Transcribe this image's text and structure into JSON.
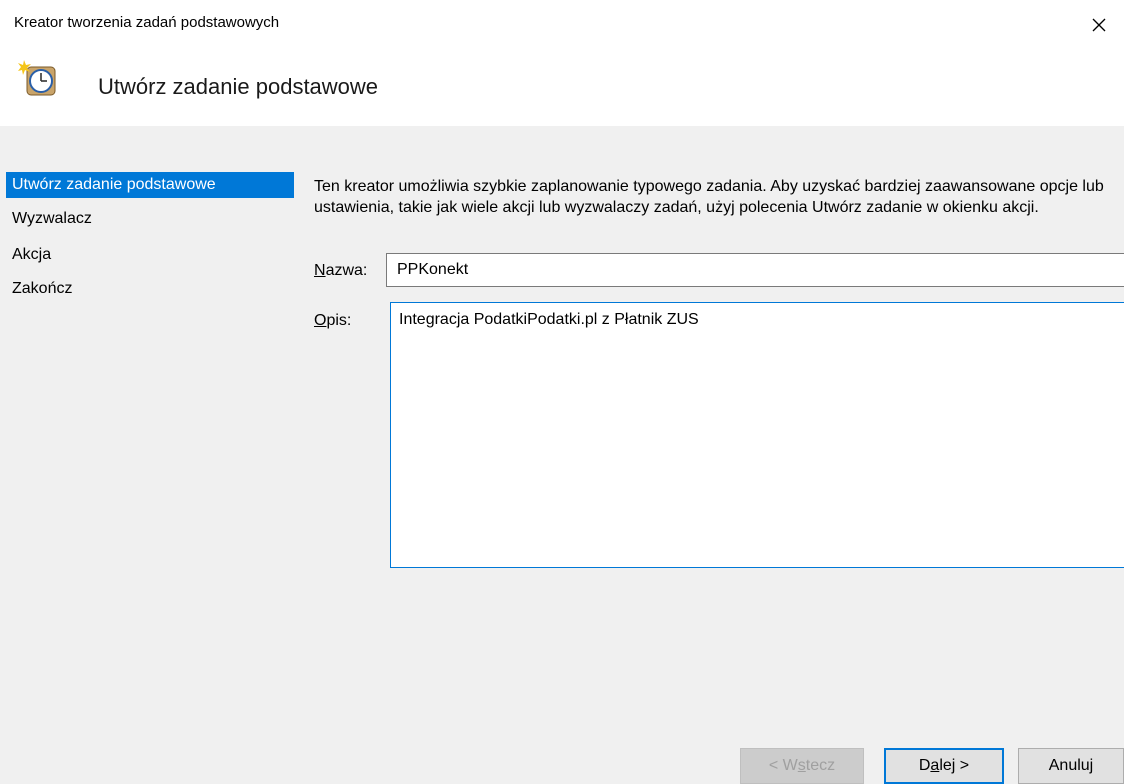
{
  "window": {
    "title": "Kreator tworzenia zadań podstawowych",
    "close_icon": "close-icon"
  },
  "header": {
    "title": "Utwórz zadanie podstawowe",
    "icon": "scheduled-task-clock-icon"
  },
  "nav": {
    "items": [
      {
        "label": "Utwórz zadanie podstawowe",
        "active": true
      },
      {
        "label": "Wyzwalacz",
        "active": false
      },
      {
        "label": "Akcja",
        "active": false
      },
      {
        "label": "Zakończ",
        "active": false
      }
    ]
  },
  "main": {
    "intro": "Ten kreator umożliwia szybkie zaplanowanie typowego zadania. Aby uzyskać bardziej zaawansowane opcje lub ustawienia, takie jak wiele akcji lub wyzwalaczy zadań, użyj polecenia Utwórz zadanie w okienku akcji.",
    "name_label_first": "N",
    "name_label_rest": "azwa:",
    "name_value": "PPKonekt",
    "desc_label_first": "O",
    "desc_label_rest": "pis:",
    "desc_value": "Integracja PodatkiPodatki.pl z Płatnik ZUS"
  },
  "buttons": {
    "back_prefix": "< W",
    "back_access": "s",
    "back_suffix": "tecz",
    "next_prefix": "D",
    "next_access": "a",
    "next_suffix": "lej >",
    "cancel": "Anuluj"
  },
  "colors": {
    "accent": "#0078d7",
    "panel": "#f0f0f0",
    "header": "#ffffff"
  }
}
